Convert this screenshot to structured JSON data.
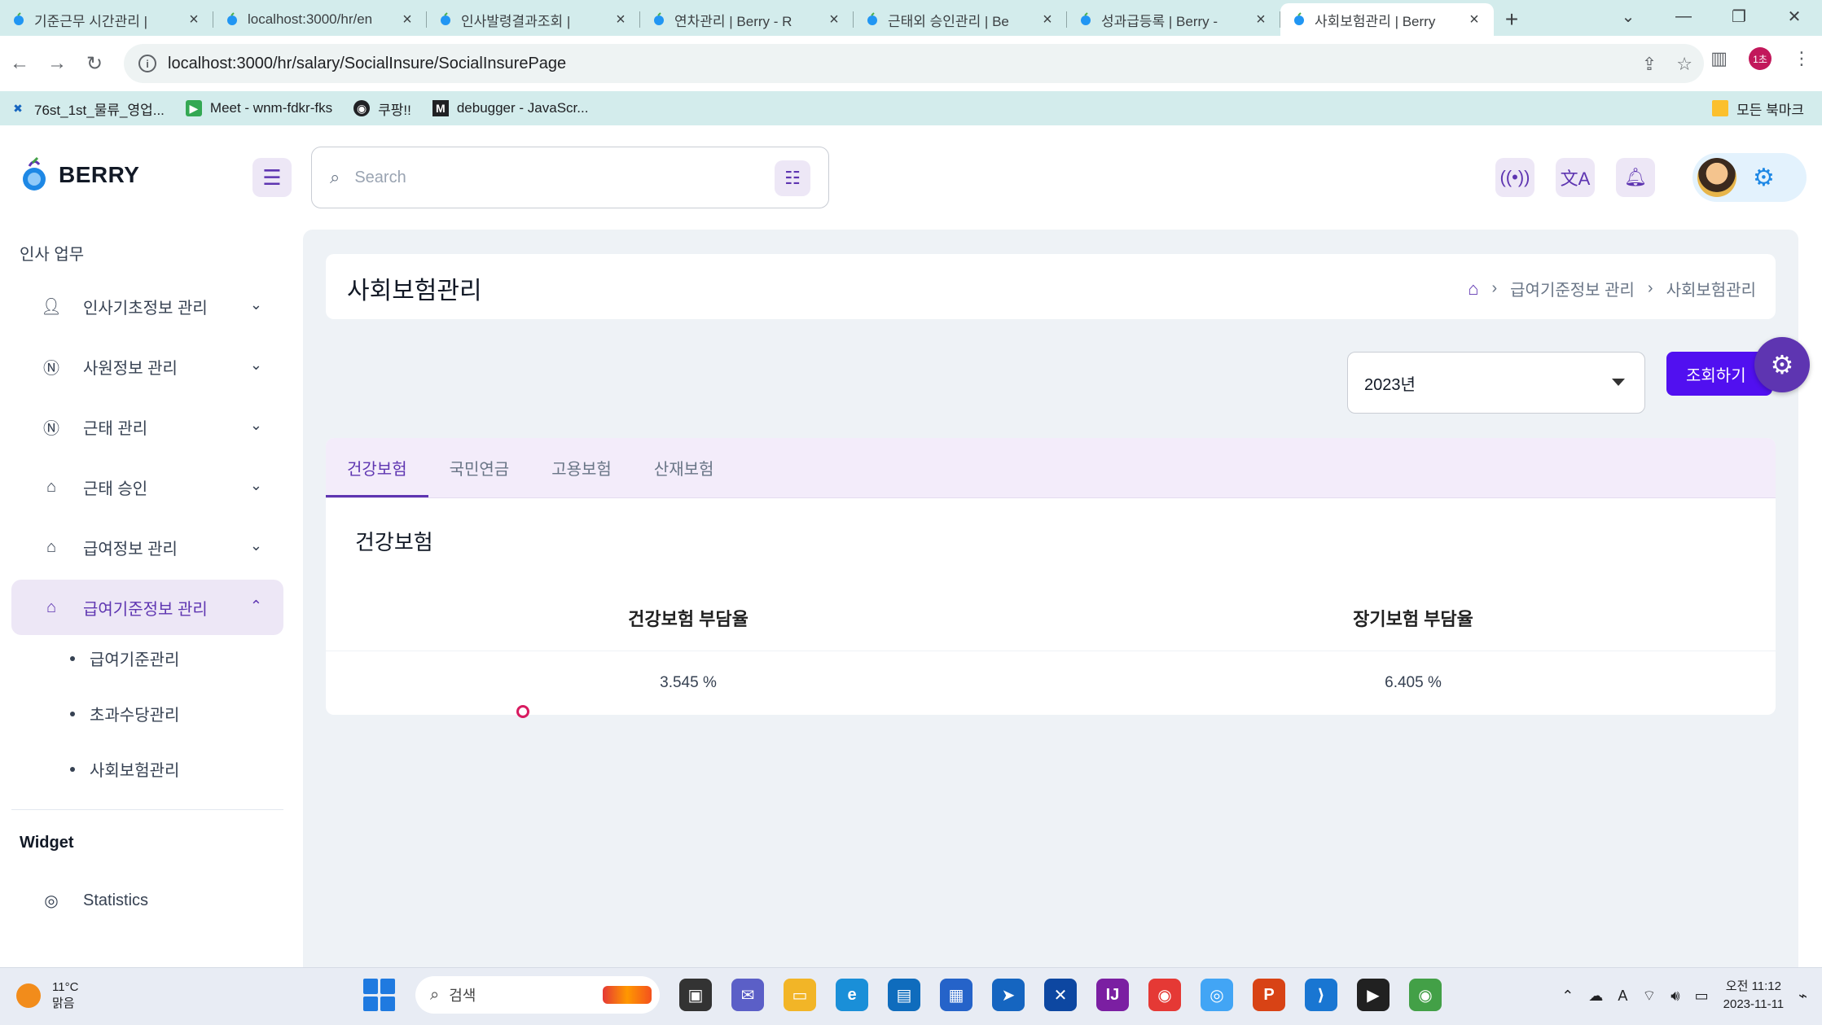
{
  "browser": {
    "tabs": [
      {
        "title": "기준근무 시간관리 |",
        "active": false
      },
      {
        "title": "localhost:3000/hr/en",
        "active": false
      },
      {
        "title": "인사발령결과조회 | ",
        "active": false
      },
      {
        "title": "연차관리 | Berry - R",
        "active": false
      },
      {
        "title": "근태외 승인관리 | Be",
        "active": false
      },
      {
        "title": "성과급등록 | Berry -",
        "active": false
      },
      {
        "title": "사회보험관리 | Berry",
        "active": true
      }
    ],
    "url": "localhost:3000/hr/salary/SocialInsure/SocialInsurePage",
    "profile_initials": "1초",
    "bookmarks": [
      {
        "label": "76st_1st_물류_영업..."
      },
      {
        "label": "Meet - wnm-fdkr-fks"
      },
      {
        "label": "쿠팡!!"
      },
      {
        "label": "debugger - JavaScr..."
      }
    ],
    "bookmarks_all": "모든 북마크"
  },
  "header": {
    "brand": "BERRY",
    "search_placeholder": "Search"
  },
  "sidebar": {
    "caption": "인사 업무",
    "items": [
      {
        "label": "인사기초정보 관리",
        "icon": "user-check-icon"
      },
      {
        "label": "사원정보 관리",
        "icon": "nfc-icon"
      },
      {
        "label": "근태 관리",
        "icon": "nfc-icon"
      },
      {
        "label": "근태 승인",
        "icon": "basket-icon"
      },
      {
        "label": "급여정보 관리",
        "icon": "basket-icon"
      },
      {
        "label": "급여기준정보 관리",
        "icon": "basket-icon"
      }
    ],
    "sub_items": [
      {
        "label": "급여기준관리"
      },
      {
        "label": "초과수당관리"
      },
      {
        "label": "사회보험관리"
      }
    ],
    "widget_section": "Widget",
    "widget_items": [
      {
        "label": "Statistics"
      }
    ]
  },
  "page": {
    "title": "사회보험관리",
    "breadcrumb": [
      "급여기준정보 관리",
      "사회보험관리"
    ],
    "year_value": "2023년",
    "query_button": "조회하기",
    "tabs": [
      "건강보험",
      "국민연금",
      "고용보험",
      "산재보험"
    ],
    "active_tab": 0,
    "section_title": "건강보험",
    "table": {
      "headers": [
        "건강보험 부담율",
        "장기보험 부담율"
      ],
      "rows": [
        [
          "3.545 %",
          "6.405 %"
        ]
      ]
    }
  },
  "taskbar": {
    "temperature": "11°C",
    "weather": "맑음",
    "search_placeholder": "검색",
    "time": "오전 11:12",
    "date": "2023-11-11"
  },
  "colors": {
    "primary": "#5e35b1",
    "primary_light": "#ede7f6",
    "button": "#5110f0",
    "chrome": "#d3ecec"
  }
}
